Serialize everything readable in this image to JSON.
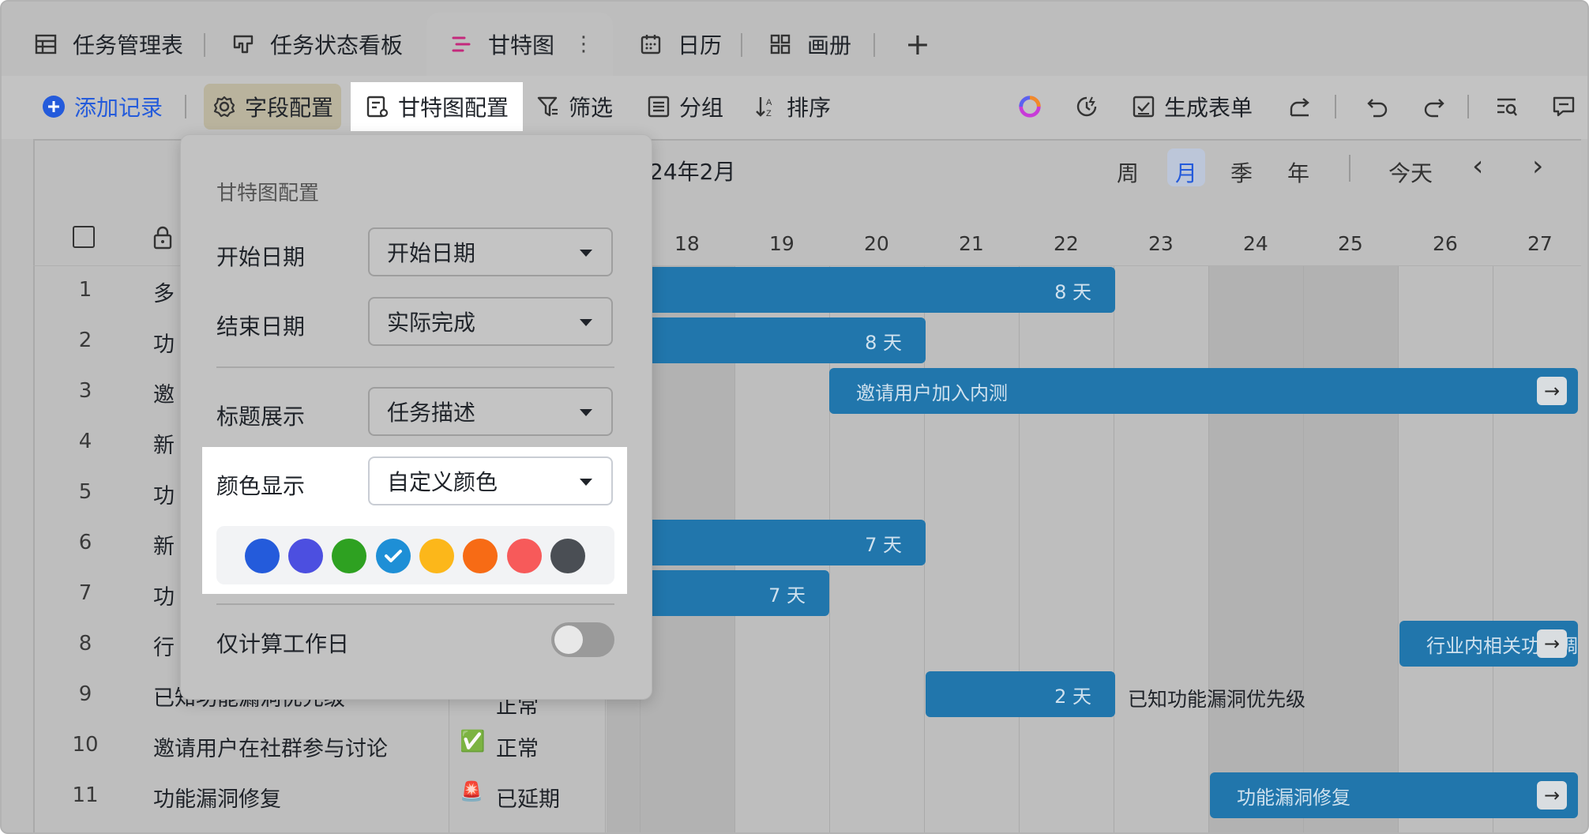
{
  "tabs": [
    {
      "label": "任务管理表",
      "icon": "table-icon"
    },
    {
      "label": "任务状态看板",
      "icon": "kanban-icon"
    },
    {
      "label": "甘特图",
      "icon": "gantt-icon",
      "active": true
    },
    {
      "label": "日历",
      "icon": "calendar-icon"
    },
    {
      "label": "画册",
      "icon": "gallery-icon"
    }
  ],
  "add_tab": "+",
  "more_tab": "⋮",
  "toolbar": {
    "add_record": "添加记录",
    "field_config": "字段配置",
    "gantt_config": "甘特图配置",
    "filter": "筛选",
    "group": "分组",
    "sort": "排序",
    "generate_form": "生成表单"
  },
  "gantt": {
    "month_label": "24年2月",
    "views": [
      "周",
      "月",
      "季",
      "年"
    ],
    "active_view": "月",
    "today": "今天",
    "prev": "‹",
    "next": "›",
    "days": [
      "18",
      "19",
      "20",
      "21",
      "22",
      "23",
      "24",
      "25",
      "26",
      "27"
    ],
    "bars": [
      {
        "row": 1,
        "label": "8 天"
      },
      {
        "row": 2,
        "label": "8 天"
      },
      {
        "row": 3,
        "label": "邀请用户加入内测"
      },
      {
        "row": 6,
        "label": "7 天"
      },
      {
        "row": 7,
        "label": "7 天"
      },
      {
        "row": 8,
        "label": "行业内相关功能调"
      },
      {
        "row": 9,
        "label": "2 天",
        "outside_label": "已知功能漏洞优先级"
      },
      {
        "row": 11,
        "label": "功能漏洞修复"
      }
    ]
  },
  "rows": [
    {
      "num": "1",
      "title": "多"
    },
    {
      "num": "2",
      "title": "功"
    },
    {
      "num": "3",
      "title": "邀"
    },
    {
      "num": "4",
      "title": "新"
    },
    {
      "num": "5",
      "title": "功"
    },
    {
      "num": "6",
      "title": "新"
    },
    {
      "num": "7",
      "title": "功"
    },
    {
      "num": "8",
      "title": "行"
    },
    {
      "num": "9",
      "title": "已知功能漏洞优先级",
      "status": "正常"
    },
    {
      "num": "10",
      "title": "邀请用户在社群参与讨论",
      "status": "正常",
      "status_icon": "✅"
    },
    {
      "num": "11",
      "title": "功能漏洞修复",
      "status": "已延期",
      "status_icon": "🚨"
    }
  ],
  "panel": {
    "title": "甘特图配置",
    "start_label": "开始日期",
    "start_value": "开始日期",
    "end_label": "结束日期",
    "end_value": "实际完成",
    "title_label": "标题展示",
    "title_value": "任务描述",
    "color_label": "颜色显示",
    "color_value": "自定义颜色",
    "colors": [
      "#245bdb",
      "#4c4fe0",
      "#2ea121",
      "#1e8fd6",
      "#fcb71a",
      "#f76b15",
      "#f75a5a",
      "#4a4e54"
    ],
    "selected_color_index": 3,
    "workday_label": "仅计算工作日",
    "workday_enabled": false
  }
}
